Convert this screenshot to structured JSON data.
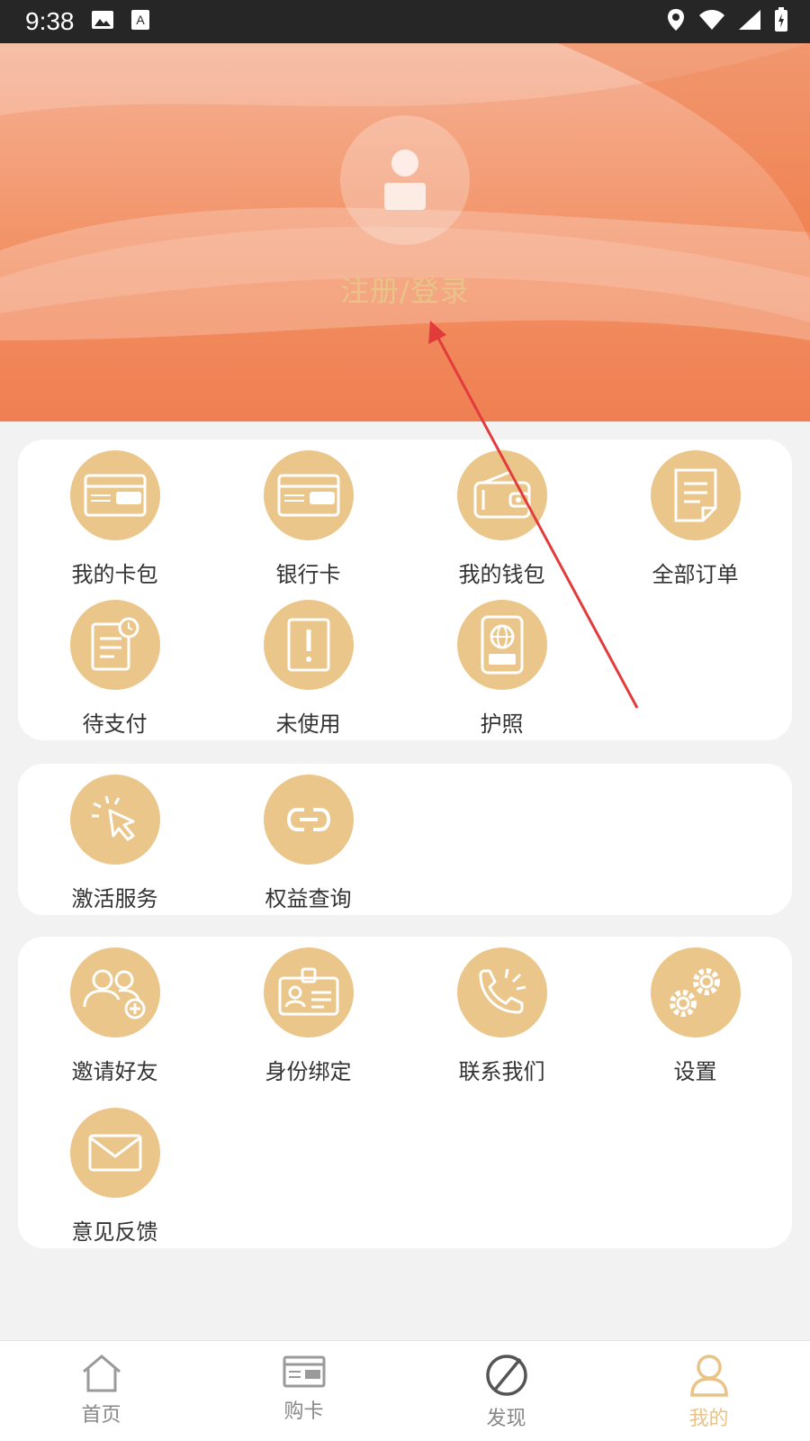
{
  "status": {
    "time": "9:38",
    "icons": [
      "image-icon",
      "text-icon",
      "location-icon",
      "wifi-icon",
      "signal-icon",
      "battery-icon"
    ]
  },
  "header": {
    "login_text": "注册/登录"
  },
  "sections": [
    {
      "items": [
        {
          "label": "我的卡包",
          "icon": "card-package-icon"
        },
        {
          "label": "银行卡",
          "icon": "bank-card-icon"
        },
        {
          "label": "我的钱包",
          "icon": "wallet-icon"
        },
        {
          "label": "全部订单",
          "icon": "orders-icon"
        },
        {
          "label": "待支付",
          "icon": "pending-payment-icon"
        },
        {
          "label": "未使用",
          "icon": "unused-icon"
        },
        {
          "label": "护照",
          "icon": "passport-icon"
        }
      ]
    },
    {
      "items": [
        {
          "label": "激活服务",
          "icon": "activate-icon"
        },
        {
          "label": "权益查询",
          "icon": "link-icon"
        }
      ]
    },
    {
      "items": [
        {
          "label": "邀请好友",
          "icon": "invite-friends-icon"
        },
        {
          "label": "身份绑定",
          "icon": "id-card-icon"
        },
        {
          "label": "联系我们",
          "icon": "phone-icon"
        },
        {
          "label": "设置",
          "icon": "settings-icon"
        },
        {
          "label": "意见反馈",
          "icon": "mail-icon"
        }
      ]
    }
  ],
  "bottom_nav": [
    {
      "label": "首页",
      "icon": "home-icon"
    },
    {
      "label": "购卡",
      "icon": "buy-card-icon"
    },
    {
      "label": "发现",
      "icon": "discover-icon"
    },
    {
      "label": "我的",
      "icon": "profile-icon",
      "active": true
    }
  ],
  "colors": {
    "accent": "#ebc68a",
    "header": "#f28f62",
    "arrow": "#e23b3b"
  }
}
